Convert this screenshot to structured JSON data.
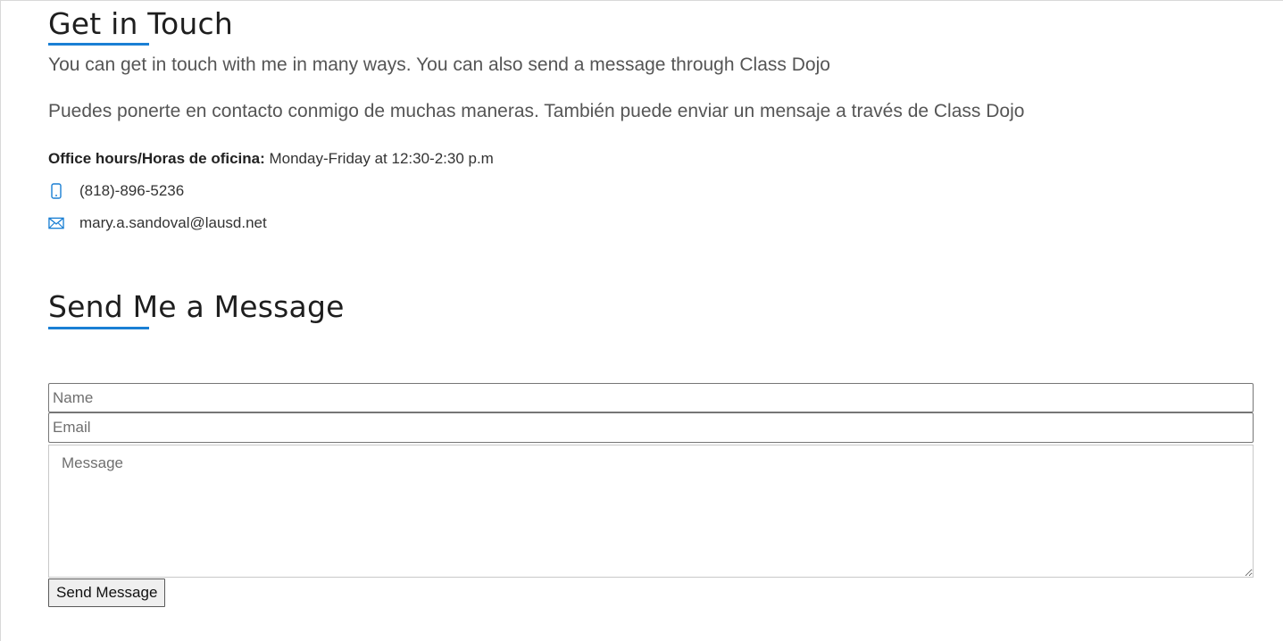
{
  "get_in_touch": {
    "title": "Get in Touch",
    "lead_en": "You can get in touch with me in many ways. You can also send a message through Class Dojo",
    "lead_es": "Puedes ponerte en contacto conmigo de muchas maneras. También puede enviar un mensaje a través de Class Dojo",
    "hours_label": "Office hours/Horas de oficina:",
    "hours_value": " Monday-Friday at 12:30-2:30 p.m",
    "phone": "(818)-896-5236",
    "email": "mary.a.sandoval@lausd.net"
  },
  "send_message": {
    "title": "Send Me a Message",
    "name_placeholder": "Name",
    "email_placeholder": "Email",
    "message_placeholder": "Message",
    "submit_label": "Send Message"
  },
  "icons": {
    "phone": "phone-icon",
    "email": "envelope-icon"
  },
  "colors": {
    "accent": "#1a7fd4",
    "heading": "#1e1e1e",
    "body_text": "#555555"
  }
}
